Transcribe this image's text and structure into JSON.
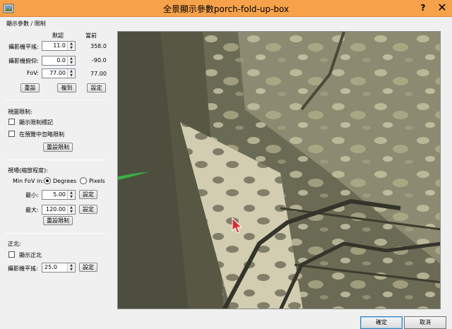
{
  "window": {
    "title": "全景顯示參數porch-fold-up-box",
    "help": "?",
    "close": "✕"
  },
  "display_params": {
    "heading": "顯示參數 / 限制",
    "col_default": "默認",
    "col_current": "當前",
    "rows": [
      {
        "label": "攝影機平搖:",
        "value": "11.0",
        "current": "358.0"
      },
      {
        "label": "攝影機俯仰:",
        "value": "0.0",
        "current": "-90.0"
      },
      {
        "label": "FoV:",
        "value": "77.00",
        "current": "77.00"
      }
    ],
    "buttons": {
      "reset": "重設",
      "copy": "複到",
      "set": "設定"
    }
  },
  "view_limits": {
    "heading": "視圖限制:",
    "show_limit_marks": "顯示限制標記",
    "ignore_in_preview": "在預覽中忽略限制",
    "reset_limits": "重設限制"
  },
  "fov_limits": {
    "heading": "視場(縮放程度):",
    "min_fov_in": "Min FoV in:",
    "degrees": "Degrees",
    "pixels": "Pixels",
    "min_label": "最小:",
    "min_value": "5.00",
    "max_label": "最大:",
    "max_value": "120.00",
    "set": "設定",
    "reset_limits": "重設限制"
  },
  "north": {
    "heading": "正北:",
    "show_north": "顯示正北",
    "pan_label": "攝影機平搖:",
    "pan_value": "25.0",
    "set": "設定"
  },
  "footer": {
    "ok": "確定",
    "cancel": "取消"
  },
  "colors": {
    "titlebar": "#f5a24b",
    "accent": "#3c7fb1"
  }
}
